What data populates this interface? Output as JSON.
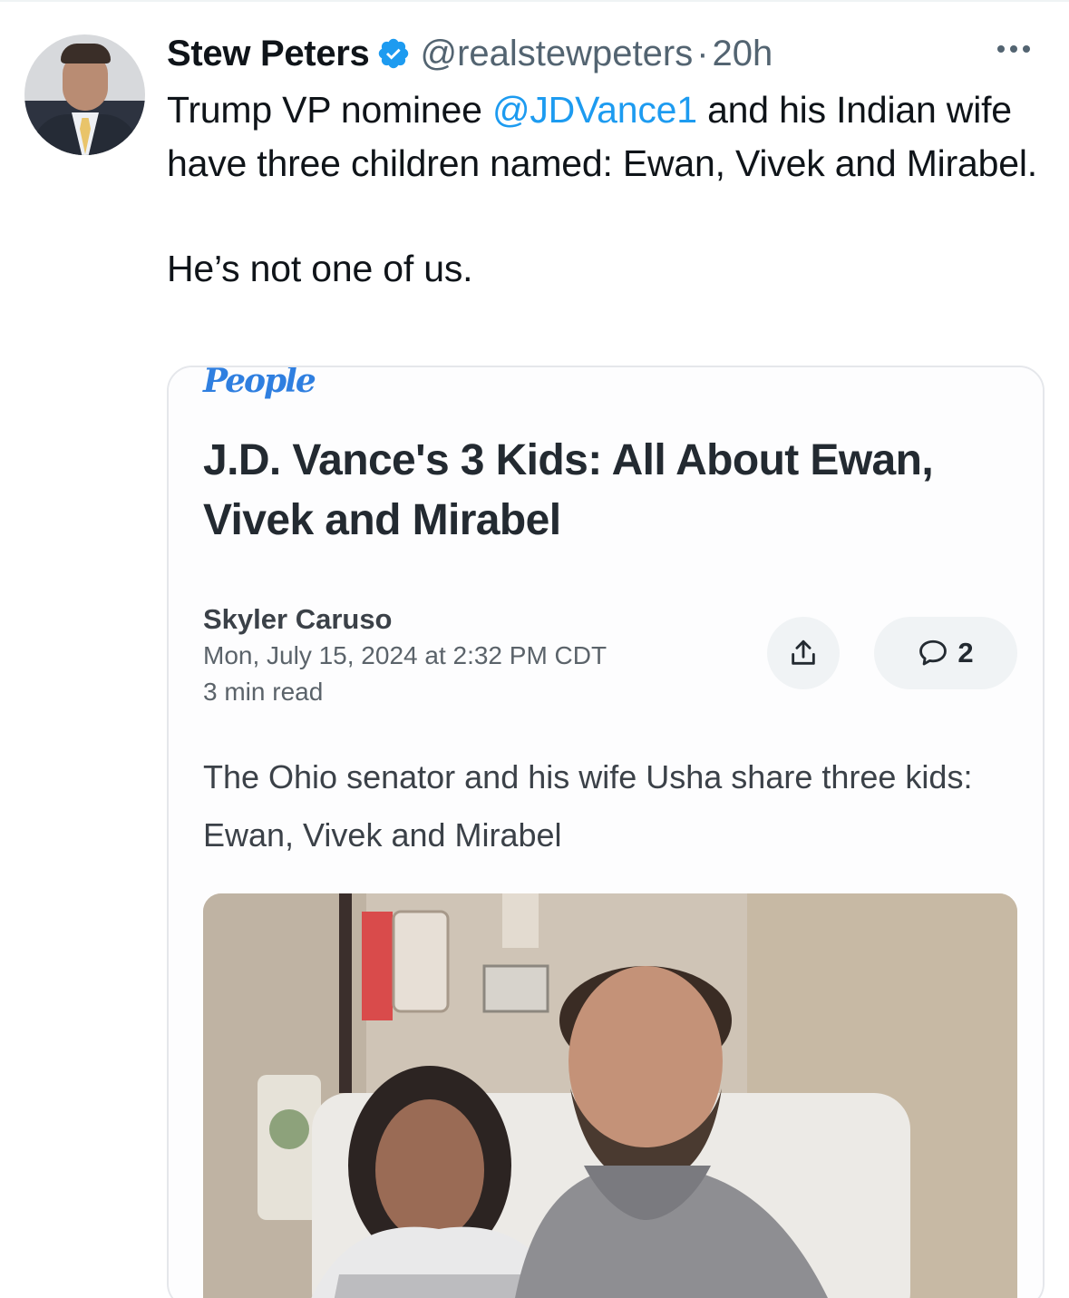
{
  "tweet": {
    "author_name": "Stew Peters",
    "handle": "@realstewpeters",
    "separator": "·",
    "time": "20h",
    "text_part1": "Trump VP nominee ",
    "mention": "@JDVance1",
    "text_part2": " and his Indian wife have three children named: Ewan, Vivek and Mirabel.",
    "text_para2": "He’s not one of us."
  },
  "card": {
    "brand": "People",
    "title": "J.D. Vance's 3 Kids: All About Ewan, Vivek and Mirabel",
    "author": "Skyler Caruso",
    "date": "Mon, July 15, 2024 at 2:32 PM CDT",
    "read_time": "3 min read",
    "comment_count": "2",
    "summary": "The Ohio senator and his wife Usha share three kids: Ewan, Vivek and Mirabel"
  },
  "colors": {
    "accent": "#1d9bf0",
    "text": "#0f1419",
    "secondary_text": "#536471",
    "people_brand": "#2f7fe0"
  },
  "icons": [
    "verified-badge-icon",
    "more-icon",
    "share-icon",
    "comment-icon"
  ]
}
